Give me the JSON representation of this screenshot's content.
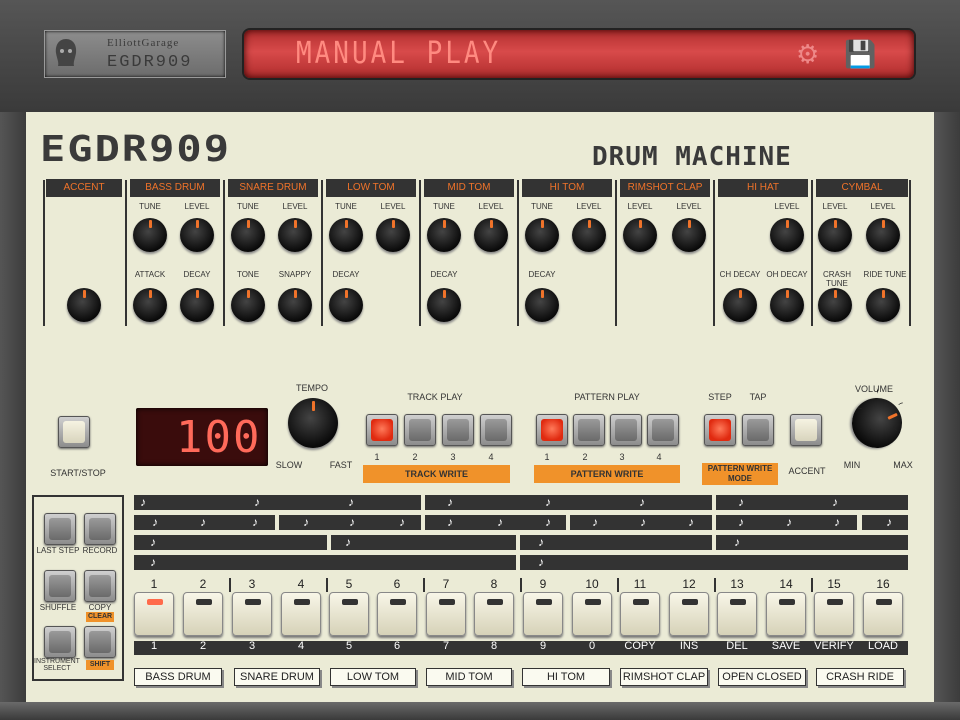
{
  "header": {
    "brand_line1": "ElliottGarage",
    "brand_line2": "EGDR909",
    "lcd_text": "MANUAL PLAY",
    "gear_icon": "⚙",
    "save_icon": "💾"
  },
  "titles": {
    "main": "EGDR909",
    "sub": "DRUM MACHINE"
  },
  "sections": [
    "ACCENT",
    "BASS DRUM",
    "SNARE DRUM",
    "LOW TOM",
    "MID TOM",
    "HI TOM",
    "RIMSHOT  CLAP",
    "HI HAT",
    "CYMBAL"
  ],
  "knob_labels": {
    "tune": "TUNE",
    "level": "LEVEL",
    "attack": "ATTACK",
    "decay": "DECAY",
    "tone": "TONE",
    "snappy": "SNAPPY",
    "ch_decay": "CH DECAY",
    "oh_decay": "OH DECAY",
    "crash_tune": "CRASH TUNE",
    "ride_tune": "RIDE TUNE"
  },
  "transport": {
    "start_stop": "START/STOP",
    "tempo": "TEMPO",
    "slow": "SLOW",
    "fast": "FAST",
    "tempo_value": "100",
    "track_play": "TRACK PLAY",
    "track_write": "TRACK WRITE",
    "pattern_play": "PATTERN PLAY",
    "pattern_write": "PATTERN WRITE",
    "step": "STEP",
    "tap": "TAP",
    "pattern_write_mode": "PATTERN WRITE MODE",
    "accent": "ACCENT",
    "volume": "VOLUME",
    "min": "MIN",
    "max": "MAX",
    "n1": "1",
    "n2": "2",
    "n3": "3",
    "n4": "4"
  },
  "seq_buttons": {
    "last_step": "LAST STEP",
    "record": "RECORD",
    "shuffle": "SHUFFLE",
    "copy": "COPY",
    "clear": "CLEAR",
    "instrument_select": "INSTRUMENT SELECT",
    "shift": "SHIFT"
  },
  "note_glyph": "♪",
  "steps_top": [
    "1",
    "2",
    "3",
    "4",
    "5",
    "6",
    "7",
    "8",
    "9",
    "10",
    "11",
    "12",
    "13",
    "14",
    "15",
    "16"
  ],
  "steps_bottom": [
    "1",
    "2",
    "3",
    "4",
    "5",
    "6",
    "7",
    "8",
    "9",
    "0",
    "COPY",
    "INS",
    "DEL",
    "SAVE",
    "VERIFY",
    "LOAD"
  ],
  "instruments": [
    "BASS DRUM",
    "SNARE DRUM",
    "LOW TOM",
    "MID TOM",
    "HI TOM",
    "RIMSHOT CLAP",
    "OPEN CLOSED",
    "CRASH RIDE"
  ],
  "state": {
    "active_step": 1,
    "tempo_bpm": 100
  }
}
